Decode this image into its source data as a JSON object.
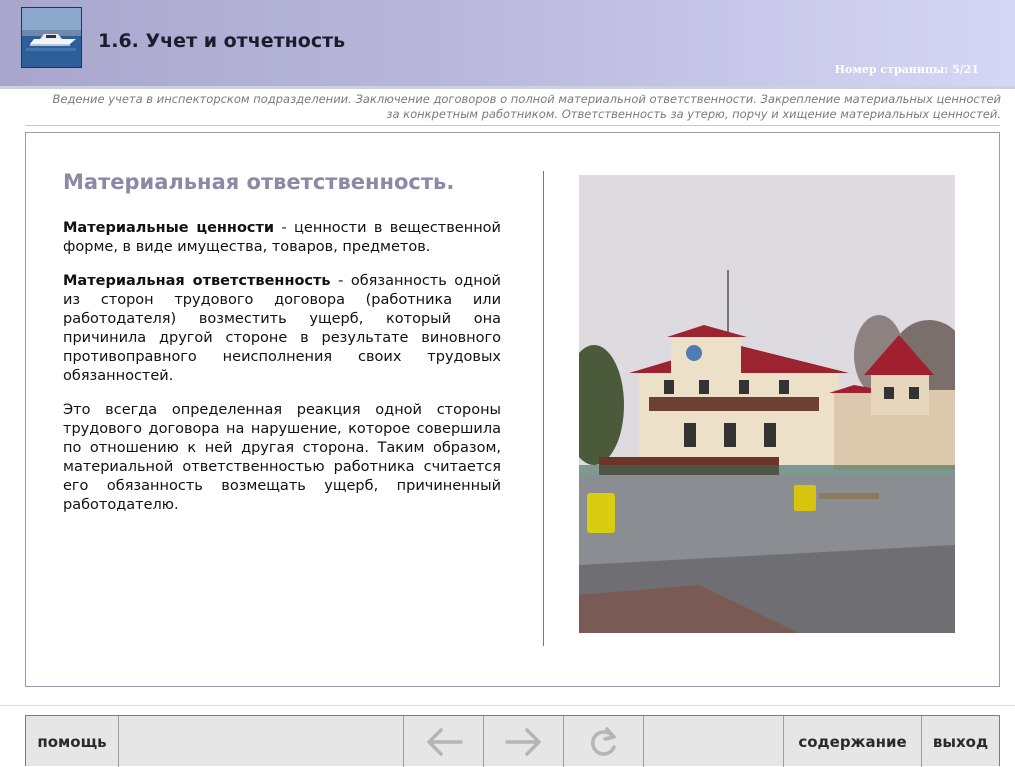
{
  "header": {
    "title": "1.6. Учет и отчетность",
    "page_number": "Номер страницы: 5/21"
  },
  "subtitle": {
    "line1": "Ведение учета в инспекторском подразделении. Заключение договоров о полной материальной ответственности. Закрепление материальных ценностей",
    "line2": "за конкретным работником. Ответственность за утерю, порчу и хищение материальных ценностей."
  },
  "content": {
    "heading": "Материальная ответственность.",
    "p1_term": "Материальные ценности",
    "p1_text": " - ценности в вещественной форме, в виде имущества, товаров, предметов.",
    "p2_term": "Материальная ответственность",
    "p2_text": " - обязанность одной из сторон трудового договора (работника или работодателя) возместить ущерб, который она причинила другой стороне в результате виновного противоправного неисполнения своих трудовых обязанностей.",
    "p3_text": "Это всегда определенная реакция одной стороны трудового договора на нарушение, которое совершила по отношению к ней другая сторона. Таким образом, материальной ответственностью работника считается его обязанность возмещать ущерб, причиненный работодателю."
  },
  "footer": {
    "help_label": "помощь",
    "contents_label": "содержание",
    "exit_label": "выход"
  },
  "icons": {
    "back": "arrow-left-icon",
    "forward": "arrow-right-icon",
    "reload": "reload-icon"
  },
  "colors": {
    "header_start": "#a8a6cc",
    "header_end": "#d6d6f6",
    "heading": "#8a8aa6",
    "footer_bg": "#e6e6e6"
  }
}
